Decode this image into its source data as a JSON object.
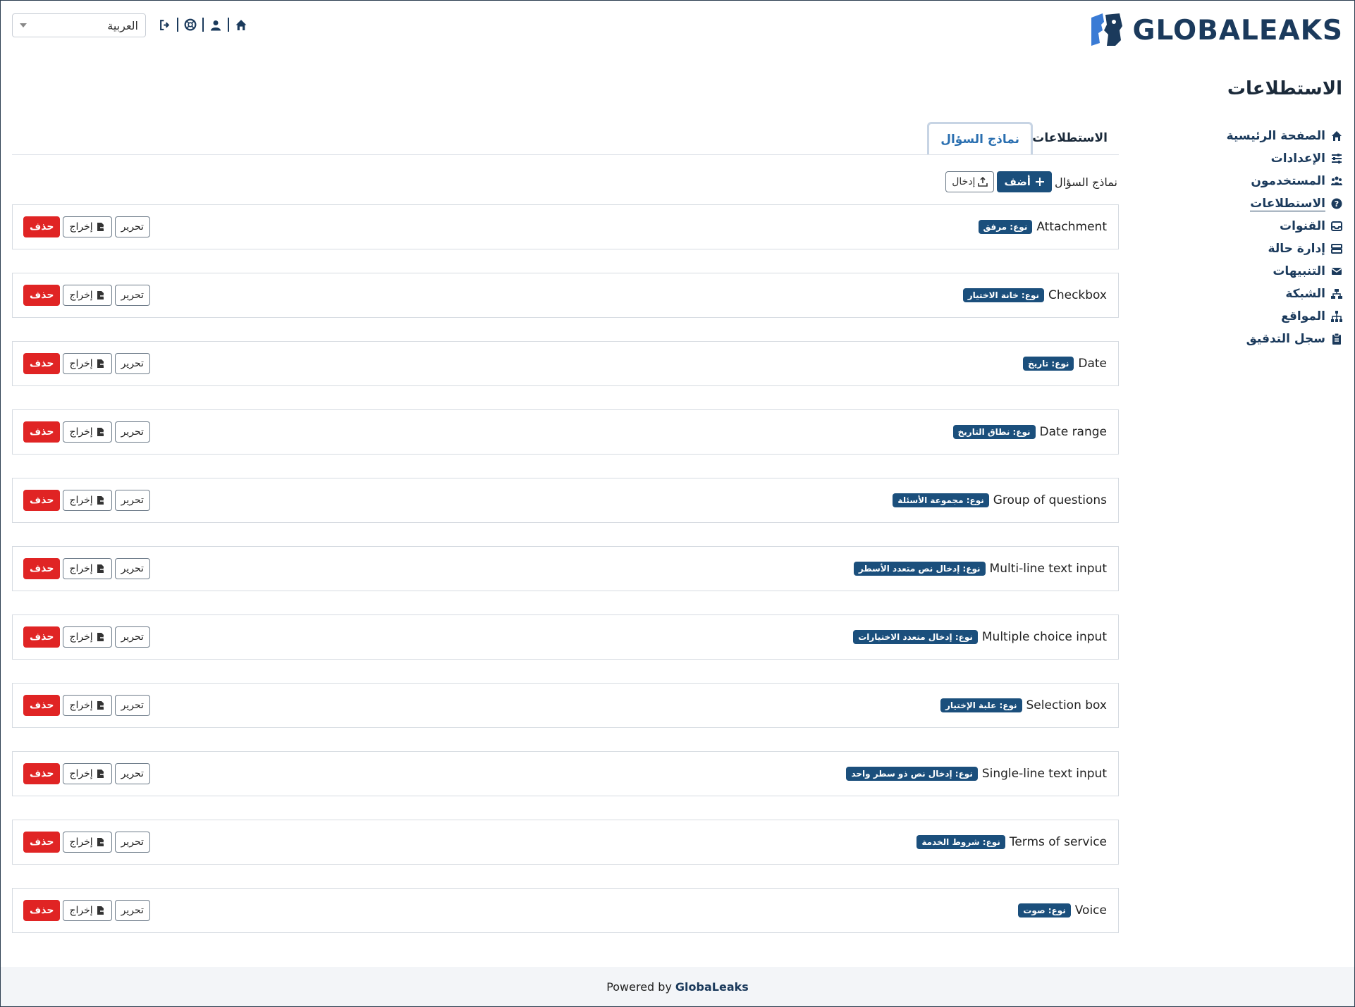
{
  "brand": {
    "name": "GLOBALEAKS"
  },
  "header": {
    "language": "العربية"
  },
  "page": {
    "title": "الاستطلاعات"
  },
  "sidebar": {
    "items": [
      {
        "label": "الصفحة الرئيسية",
        "icon": "home-icon"
      },
      {
        "label": "الإعدادات",
        "icon": "sliders-icon"
      },
      {
        "label": "المستخدمون",
        "icon": "users-icon"
      },
      {
        "label": "الاستطلاعات",
        "icon": "question-circle-icon",
        "active": true
      },
      {
        "label": "القنوات",
        "icon": "inbox-icon"
      },
      {
        "label": "إدارة حالة",
        "icon": "server-icon"
      },
      {
        "label": "التنبيهات",
        "icon": "envelope-icon"
      },
      {
        "label": "الشبكة",
        "icon": "network-icon"
      },
      {
        "label": "المواقع",
        "icon": "sitemap-icon"
      },
      {
        "label": "سجل التدقيق",
        "icon": "clipboard-icon"
      }
    ]
  },
  "tabs": [
    {
      "label": "الاستطلاعات",
      "active": false
    },
    {
      "label": "نماذج السؤال",
      "active": true
    }
  ],
  "toolbar": {
    "label": "نماذج السؤال",
    "add_label": "أضف",
    "import_label": "إدخال"
  },
  "actions": {
    "edit": "تحرير",
    "export": "إخراج",
    "delete": "حذف"
  },
  "templates": [
    {
      "name": "Attachment",
      "type": "نوع: مرفق"
    },
    {
      "name": "Checkbox",
      "type": "نوع: خانة الاختيار"
    },
    {
      "name": "Date",
      "type": "نوع: تاريخ"
    },
    {
      "name": "Date range",
      "type": "نوع: نطاق التاريخ"
    },
    {
      "name": "Group of questions",
      "type": "نوع: مجموعة الأسئلة"
    },
    {
      "name": "Multi-line text input",
      "type": "نوع: إدخال نص متعدد الأسطر"
    },
    {
      "name": "Multiple choice input",
      "type": "نوع: إدخال متعدد الاختيارات"
    },
    {
      "name": "Selection box",
      "type": "نوع: علبة الإختيار"
    },
    {
      "name": "Single-line text input",
      "type": "نوع: إدخال نص ذو سطر واحد"
    },
    {
      "name": "Terms of service",
      "type": "نوع: شروط الخدمة"
    },
    {
      "name": "Voice",
      "type": "نوع: صوت"
    }
  ],
  "footer": {
    "prefix": "Powered by",
    "brand": "GlobaLeaks"
  },
  "colors": {
    "primary": "#1b4f7c",
    "danger": "#e02424",
    "text": "#1b3a5c"
  }
}
